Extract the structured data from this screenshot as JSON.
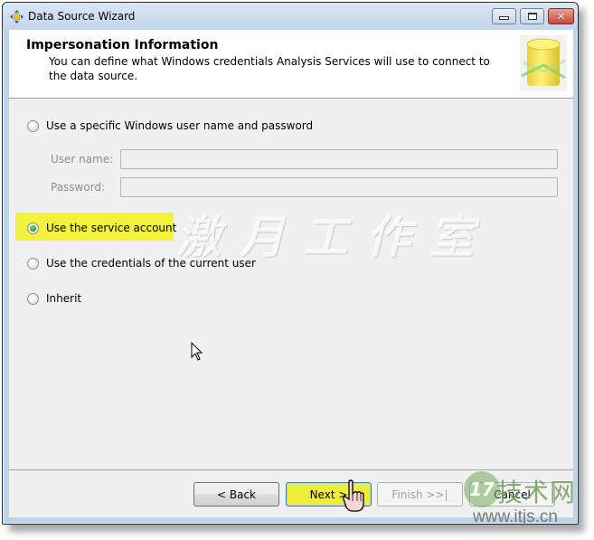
{
  "window": {
    "title": "Data Source Wizard",
    "app_icon": "wizard-cube-icon",
    "controls": {
      "minimize": "minimize-icon",
      "maximize": "maximize-icon",
      "close": "close-icon"
    }
  },
  "header": {
    "title": "Impersonation Information",
    "description": "You can define what Windows credentials Analysis Services will use to connect to the data source.",
    "image": "database-cylinder-icon"
  },
  "options": [
    {
      "label": "Use a specific Windows user name and password",
      "checked": false
    },
    {
      "label": "Use the service account",
      "checked": true,
      "highlighted": true
    },
    {
      "label": "Use the credentials of the current user",
      "checked": false
    },
    {
      "label": "Inherit",
      "checked": false
    }
  ],
  "credentials": {
    "username_label": "User name:",
    "username_value": "",
    "password_label": "Password:",
    "password_value": "",
    "enabled": false
  },
  "buttons": {
    "back": "< Back",
    "next": "Next >",
    "finish": "Finish >>|",
    "cancel": "Cancel"
  },
  "watermarks": {
    "center_text": "激月工作室",
    "logo_number": "17",
    "logo_text": "技术网",
    "logo_url": "www.itjs.cn"
  },
  "colors": {
    "highlight": "#f2f23c",
    "next_button": "#eeee3a",
    "window_frame": "#bcd3ea"
  }
}
